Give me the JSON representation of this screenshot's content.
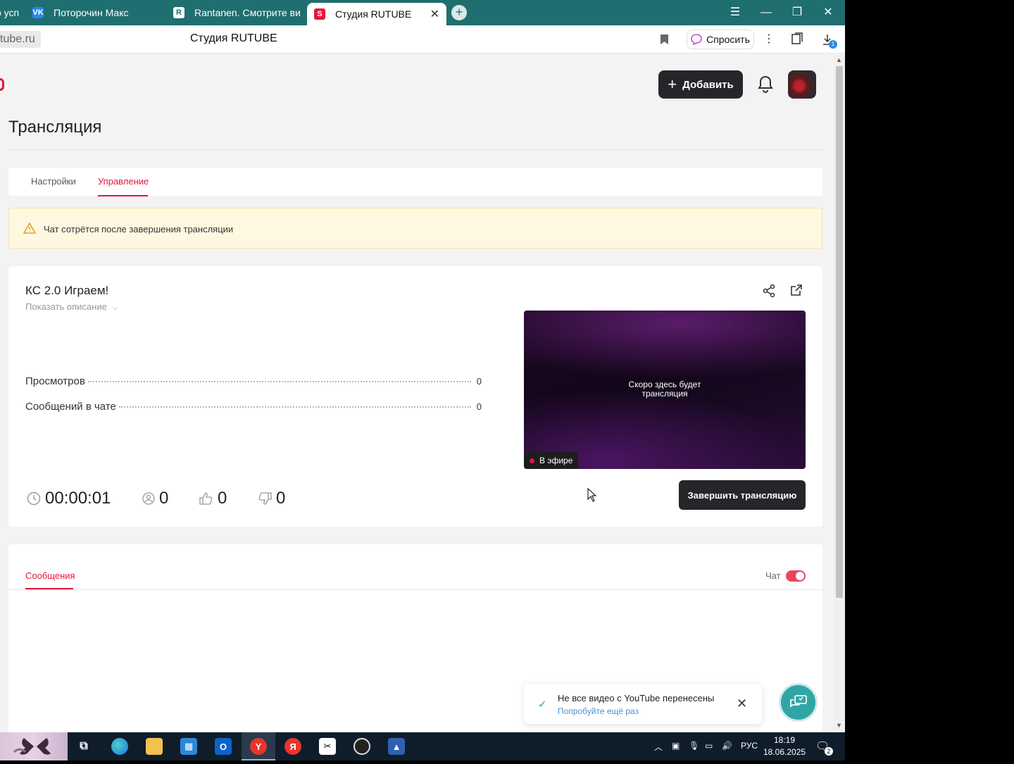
{
  "browser": {
    "tabs": [
      {
        "label": "о усп",
        "icon": ""
      },
      {
        "label": "Поторочин Макс",
        "icon": "VK"
      },
      {
        "label": "Rantanen. Смотрите виде",
        "icon": "R"
      },
      {
        "label": "Студия RUTUBE",
        "icon": "S",
        "active": true
      }
    ],
    "url": "tube.ru",
    "page_heading": "Студия RUTUBE",
    "ask_label": "Спросить",
    "downloads_badge": "1"
  },
  "header": {
    "add_label": "Добавить"
  },
  "page": {
    "title": "Трансляция",
    "tabs": [
      {
        "label": "Настройки"
      },
      {
        "label": "Управление",
        "active": true
      }
    ],
    "warning": "Чат сотрётся после завершения трансляции"
  },
  "stream": {
    "title": "КС 2.0 Играем!",
    "show_description": "Показать описание",
    "stats": [
      {
        "label": "Просмотров",
        "value": "0"
      },
      {
        "label": "Сообщений в чате",
        "value": "0"
      }
    ],
    "player_text_line1": "Скоро здесь будет",
    "player_text_line2": "трансляция",
    "live_label": "В эфире",
    "duration": "00:00:01",
    "viewers": "0",
    "likes": "0",
    "dislikes": "0",
    "end_label": "Завершить трансляцию"
  },
  "messages": {
    "tab_label": "Сообщения",
    "chat_label": "Чат",
    "chat_enabled": true
  },
  "toast": {
    "title": "Не все видео с YouTube перенесены",
    "subtitle": "Попробуйте ещё раз"
  },
  "taskbar": {
    "language": "РУС",
    "time": "18:19",
    "date": "18.06.2025",
    "notification_count": "2",
    "apps": [
      "task-view",
      "edge",
      "file-explorer",
      "microsoft-store",
      "outlook",
      "yandex-browser",
      "yandex",
      "capcut",
      "obs-studio",
      "game"
    ]
  },
  "colors": {
    "accent": "#e3163e",
    "tabstrip": "#1f6e70",
    "dark_button": "#24262a",
    "warning_bg": "#fff8e1",
    "support_button": "#2fa6a6"
  }
}
